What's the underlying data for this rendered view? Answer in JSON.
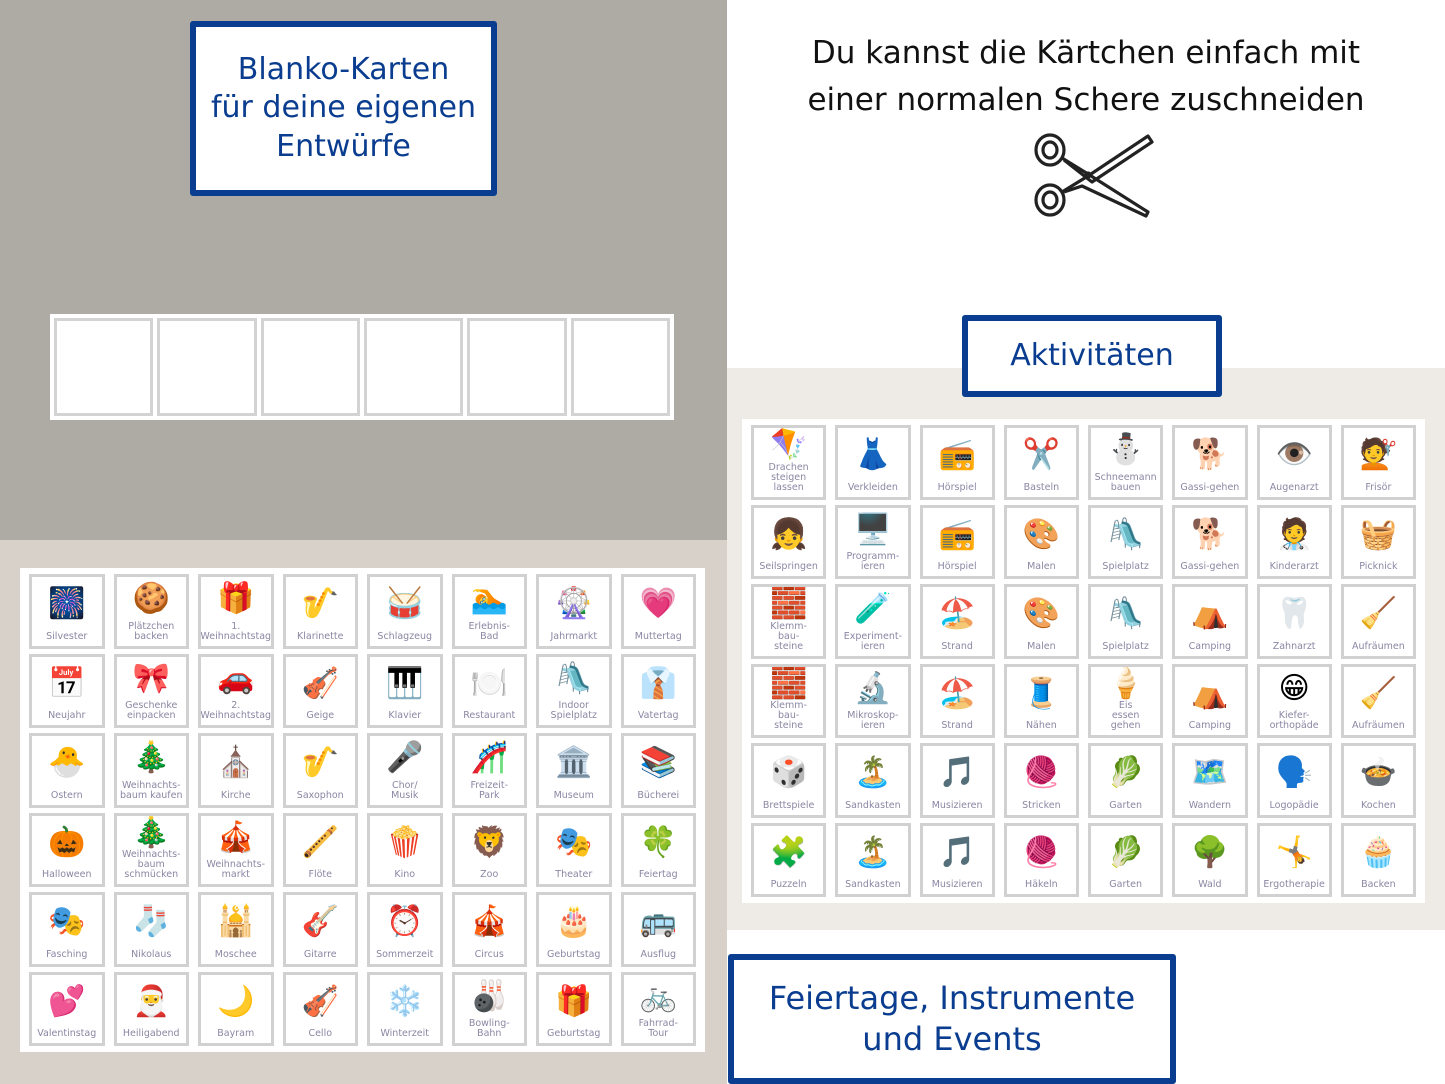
{
  "colors": {
    "accent_blue": "#0a3d8f",
    "panel_grey": "#aeaba5",
    "panel_beige": "#d8d1ca",
    "panel_light": "#eeebe7",
    "card_border": "#d1d1d1",
    "card_label": "#8a87a3"
  },
  "blank_section": {
    "title_lines": [
      "Blanko-Karten",
      "für deine eigenen",
      "Entwürfe"
    ],
    "blank_card_count": 6
  },
  "cut_hint": {
    "lines": [
      "Du kannst die Kärtchen einfach mit",
      "einer normalen Schere zuschneiden"
    ],
    "icon": "scissors-icon"
  },
  "activities_section": {
    "title": "Aktivitäten",
    "cards": [
      {
        "label": "Drachen\nsteigen\nlassen",
        "icon": "🪁"
      },
      {
        "label": "Verkleiden",
        "icon": "👗"
      },
      {
        "label": "Hörspiel",
        "icon": "📻"
      },
      {
        "label": "Basteln",
        "icon": "✂️"
      },
      {
        "label": "Schneemann\nbauen",
        "icon": "⛄"
      },
      {
        "label": "Gassi-gehen",
        "icon": "🐕"
      },
      {
        "label": "Augenarzt",
        "icon": "👁️"
      },
      {
        "label": "Frisör",
        "icon": "💇"
      },
      {
        "label": "Seilspringen",
        "icon": "👧"
      },
      {
        "label": "Programm-\nieren",
        "icon": "🖥️"
      },
      {
        "label": "Hörspiel",
        "icon": "📻"
      },
      {
        "label": "Malen",
        "icon": "🎨"
      },
      {
        "label": "Spielplatz",
        "icon": "🛝"
      },
      {
        "label": "Gassi-gehen",
        "icon": "🐕"
      },
      {
        "label": "Kinderarzt",
        "icon": "🧑‍⚕️"
      },
      {
        "label": "Picknick",
        "icon": "🧺"
      },
      {
        "label": "Klemm-\nbau-\nsteine",
        "icon": "🧱"
      },
      {
        "label": "Experiment-\nieren",
        "icon": "🧪"
      },
      {
        "label": "Strand",
        "icon": "🏖️"
      },
      {
        "label": "Malen",
        "icon": "🎨"
      },
      {
        "label": "Spielplatz",
        "icon": "🛝"
      },
      {
        "label": "Camping",
        "icon": "⛺"
      },
      {
        "label": "Zahnarzt",
        "icon": "🦷"
      },
      {
        "label": "Aufräumen",
        "icon": "🧹"
      },
      {
        "label": "Klemm-\nbau-\nsteine",
        "icon": "🧱"
      },
      {
        "label": "Mikroskop-\nieren",
        "icon": "🔬"
      },
      {
        "label": "Strand",
        "icon": "🏖️"
      },
      {
        "label": "Nähen",
        "icon": "🧵"
      },
      {
        "label": "Eis\nessen\ngehen",
        "icon": "🍦"
      },
      {
        "label": "Camping",
        "icon": "⛺"
      },
      {
        "label": "Kiefer-\northopäde",
        "icon": "😁"
      },
      {
        "label": "Aufräumen",
        "icon": "🧹"
      },
      {
        "label": "Brettspiele",
        "icon": "🎲"
      },
      {
        "label": "Sandkasten",
        "icon": "🏝️"
      },
      {
        "label": "Musizieren",
        "icon": "🎵"
      },
      {
        "label": "Stricken",
        "icon": "🧶"
      },
      {
        "label": "Garten",
        "icon": "🥬"
      },
      {
        "label": "Wandern",
        "icon": "🗺️"
      },
      {
        "label": "Logopädie",
        "icon": "🗣️"
      },
      {
        "label": "Kochen",
        "icon": "🍲"
      },
      {
        "label": "Puzzeln",
        "icon": "🧩"
      },
      {
        "label": "Sandkasten",
        "icon": "🏝️"
      },
      {
        "label": "Musizieren",
        "icon": "🎵"
      },
      {
        "label": "Häkeln",
        "icon": "🧶"
      },
      {
        "label": "Garten",
        "icon": "🥬"
      },
      {
        "label": "Wald",
        "icon": "🌳"
      },
      {
        "label": "Ergotherapie",
        "icon": "🤸"
      },
      {
        "label": "Backen",
        "icon": "🧁"
      }
    ]
  },
  "events_section": {
    "title_lines": [
      "Feiertage, Instrumente",
      "und Events"
    ],
    "cards": [
      {
        "label": "Silvester",
        "icon": "🎆"
      },
      {
        "label": "Plätzchen\nbacken",
        "icon": "🍪"
      },
      {
        "label": "1.\nWeihnachtstag",
        "icon": "🎁"
      },
      {
        "label": "Klarinette",
        "icon": "🎷"
      },
      {
        "label": "Schlagzeug",
        "icon": "🥁"
      },
      {
        "label": "Erlebnis-\nBad",
        "icon": "🏊"
      },
      {
        "label": "Jahrmarkt",
        "icon": "🎡"
      },
      {
        "label": "Muttertag",
        "icon": "💗"
      },
      {
        "label": "Neujahr",
        "icon": "📅"
      },
      {
        "label": "Geschenke\neinpacken",
        "icon": "🎀"
      },
      {
        "label": "2.\nWeihnachtstag",
        "icon": "🚗"
      },
      {
        "label": "Geige",
        "icon": "🎻"
      },
      {
        "label": "Klavier",
        "icon": "🎹"
      },
      {
        "label": "Restaurant",
        "icon": "🍽️"
      },
      {
        "label": "Indoor\nSpielplatz",
        "icon": "🛝"
      },
      {
        "label": "Vatertag",
        "icon": "👔"
      },
      {
        "label": "Ostern",
        "icon": "🐣"
      },
      {
        "label": "Weihnachts-\nbaum kaufen",
        "icon": "🎄"
      },
      {
        "label": "Kirche",
        "icon": "⛪"
      },
      {
        "label": "Saxophon",
        "icon": "🎷"
      },
      {
        "label": "Chor/\nMusik",
        "icon": "🎤"
      },
      {
        "label": "Freizeit-\nPark",
        "icon": "🎢"
      },
      {
        "label": "Museum",
        "icon": "🏛️"
      },
      {
        "label": "Bücherei",
        "icon": "📚"
      },
      {
        "label": "Halloween",
        "icon": "🎃"
      },
      {
        "label": "Weihnachts-\nbaum\nschmücken",
        "icon": "🎄"
      },
      {
        "label": "Weihnachts-\nmarkt",
        "icon": "🎪"
      },
      {
        "label": "Flöte",
        "icon": "🪈"
      },
      {
        "label": "Kino",
        "icon": "🍿"
      },
      {
        "label": "Zoo",
        "icon": "🦁"
      },
      {
        "label": "Theater",
        "icon": "🎭"
      },
      {
        "label": "Feiertag",
        "icon": "🍀"
      },
      {
        "label": "Fasching",
        "icon": "🎭"
      },
      {
        "label": "Nikolaus",
        "icon": "🧦"
      },
      {
        "label": "Moschee",
        "icon": "🕌"
      },
      {
        "label": "Gitarre",
        "icon": "🎸"
      },
      {
        "label": "Sommerzeit",
        "icon": "⏰"
      },
      {
        "label": "Circus",
        "icon": "🎪"
      },
      {
        "label": "Geburtstag",
        "icon": "🎂"
      },
      {
        "label": "Ausflug",
        "icon": "🚌"
      },
      {
        "label": "Valentinstag",
        "icon": "💕"
      },
      {
        "label": "Heiligabend",
        "icon": "🎅"
      },
      {
        "label": "Bayram",
        "icon": "🌙"
      },
      {
        "label": "Cello",
        "icon": "🎻"
      },
      {
        "label": "Winterzeit",
        "icon": "❄️"
      },
      {
        "label": "Bowling-\nBahn",
        "icon": "🎳"
      },
      {
        "label": "Geburtstag",
        "icon": "🎁"
      },
      {
        "label": "Fahrrad-\nTour",
        "icon": "🚲"
      }
    ]
  }
}
